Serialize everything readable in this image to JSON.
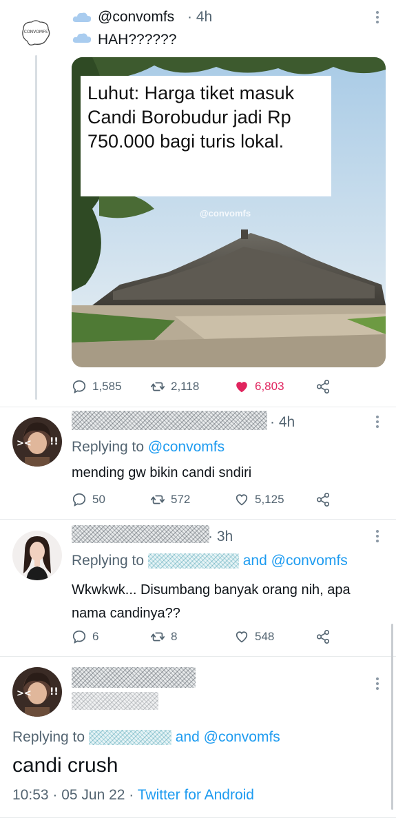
{
  "tweet1": {
    "handle": "@convomfs",
    "time_sep": "· 4h",
    "text": "HAH??????",
    "avatar_text": "CONVOMFS",
    "image": {
      "caption": "Luhut: Harga tiket masuk Candi Borobudur jadi Rp 750.000 bagi turis lokal.",
      "watermark": "@convomfs"
    },
    "actions": {
      "replies": "1,585",
      "retweets": "2,118",
      "likes": "6,803"
    },
    "colors": {
      "like": "#e0245e",
      "like_count": "#e0245e"
    }
  },
  "reply1": {
    "time": "· 4h",
    "replying_label": "Replying to",
    "replying_handle": "@convomfs",
    "text": "mending gw bikin candi sndiri",
    "actions": {
      "replies": "50",
      "retweets": "572",
      "likes": "5,125"
    }
  },
  "reply2": {
    "time": "· 3h",
    "replying_label": "Replying to",
    "replying_and": "and @convomfs",
    "text": "Wkwkwk... Disumbang banyak orang nih, apa nama candinya??",
    "actions": {
      "replies": "6",
      "retweets": "8",
      "likes": "548"
    }
  },
  "main_reply": {
    "replying_label": "Replying to",
    "replying_and": "and @convomfs",
    "text": "candi crush",
    "time": "10:53 · 05 Jun 22 · ",
    "source": "Twitter for Android"
  },
  "icons": [
    "reply-icon",
    "retweet-icon",
    "like-icon",
    "share-icon",
    "more-icon",
    "cloud-icon"
  ],
  "accent": "#1d9bf0"
}
